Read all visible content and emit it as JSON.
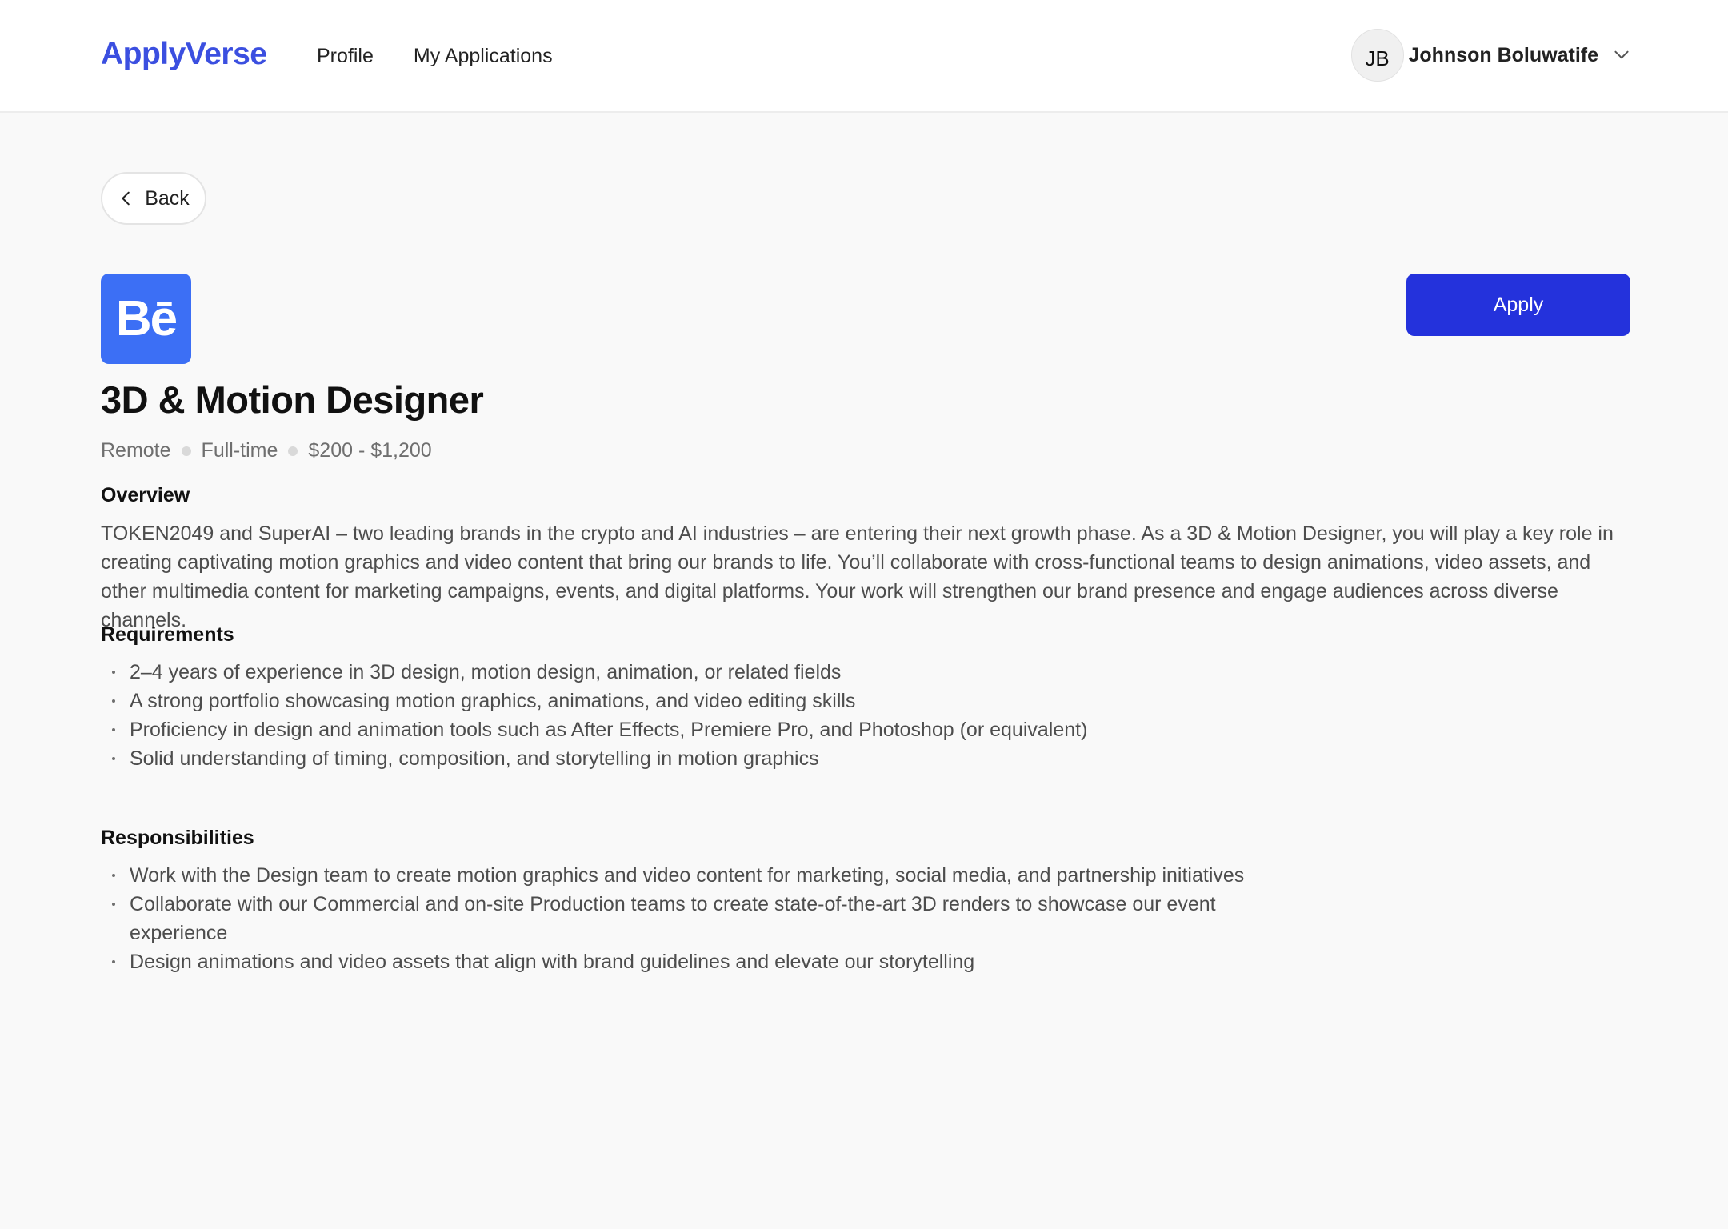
{
  "header": {
    "brand": "ApplyVerse",
    "nav": [
      "Profile",
      "My Applications"
    ],
    "user": {
      "initials": "JB",
      "name": "Johnson Boluwatife",
      "dropdown_icon": "chevron-down-icon"
    }
  },
  "back": {
    "label": "Back",
    "icon": "chevron-left-icon"
  },
  "job": {
    "company_logo_text": "Bē",
    "company_logo_color": "#3c6ff5",
    "title": "3D & Motion Designer",
    "meta": [
      "Remote",
      "Full-time",
      "$200 - $1,200"
    ],
    "apply_label": "Apply",
    "apply_color": "#2432dc"
  },
  "overview": {
    "heading": "Overview",
    "text": "TOKEN2049 and SuperAI – two leading brands in the crypto and AI industries – are entering their next growth phase. As a 3D & Motion Designer, you will play a key role in creating captivating motion graphics and video content that bring our brands to life. You’ll collaborate with cross-functional teams to design animations, video assets, and other multimedia content for marketing campaigns, events, and digital platforms. Your work will strengthen our brand presence and engage audiences across diverse channels."
  },
  "requirements": {
    "heading": "Requirements",
    "items": [
      "2–4 years of experience in 3D design, motion design, animation, or related fields",
      "A strong portfolio showcasing motion graphics, animations, and video editing skills",
      "Proficiency in design and animation tools such as After Effects, Premiere Pro, and Photoshop (or equivalent)",
      "Solid understanding of timing, composition, and storytelling in motion graphics"
    ]
  },
  "responsibilities": {
    "heading": "Responsibilities",
    "items": [
      "Work with the Design team to create motion graphics and video content for marketing, social media, and partnership initiatives",
      "Collaborate with our Commercial and on-site Production teams to create state-of-the-art 3D renders to showcase our event experience",
      "Design animations and video assets that align with brand guidelines and elevate our storytelling"
    ]
  },
  "colors": {
    "brand": "#3b4fe0",
    "page_background": "#f9f9f9"
  }
}
